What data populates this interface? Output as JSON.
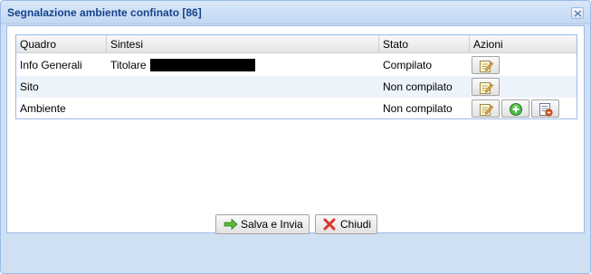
{
  "window": {
    "title": "Segnalazione ambiente confinato [86]",
    "close_icon": "close-icon"
  },
  "grid": {
    "columns": [
      "Quadro",
      "Sintesi",
      "Stato",
      "Azioni"
    ],
    "rows": [
      {
        "quadro": "Info Generali",
        "sintesi": "Titolare",
        "sintesi_redacted": true,
        "stato": "Compilato",
        "actions": [
          "edit-icon"
        ]
      },
      {
        "quadro": "Sito",
        "sintesi": "",
        "stato": "Non compilato",
        "actions": [
          "edit-icon"
        ]
      },
      {
        "quadro": "Ambiente",
        "sintesi": "",
        "stato": "Non compilato",
        "actions": [
          "edit-icon",
          "add-icon",
          "delete-list-icon"
        ]
      }
    ]
  },
  "footer": {
    "save_label": "Salva e Invia",
    "close_label": "Chiudi"
  },
  "colors": {
    "title_text": "#15428b",
    "border": "#99bbe8",
    "alt_row": "#edf3fb"
  }
}
